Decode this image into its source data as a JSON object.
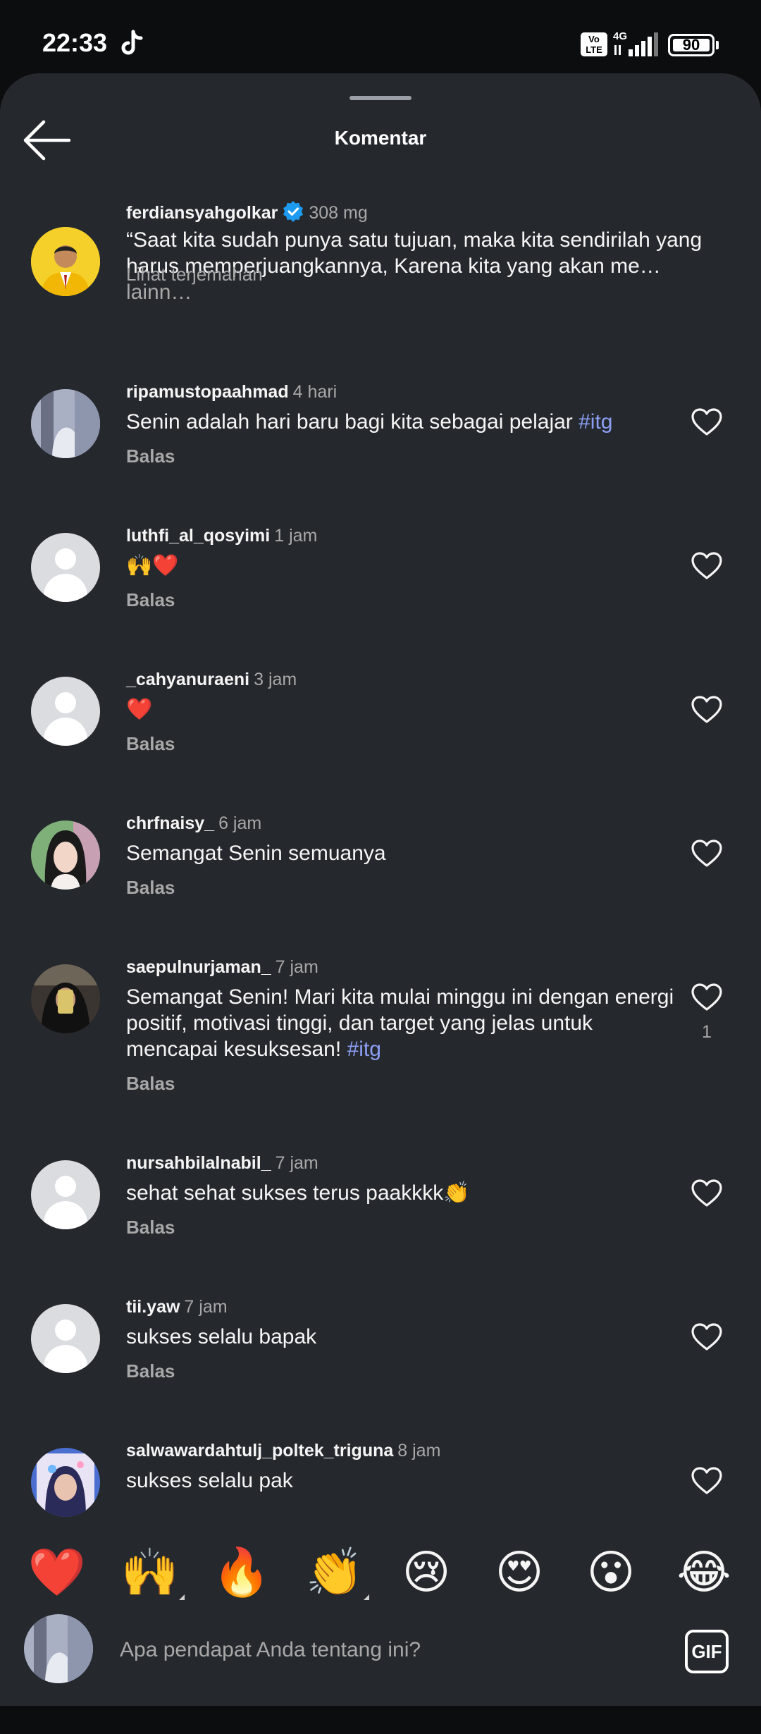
{
  "status_bar": {
    "time": "22:33",
    "volte": "Vo LTE",
    "network": "4G",
    "battery": "90"
  },
  "header": {
    "title": "Komentar"
  },
  "caption": {
    "username": "ferdiansyahgolkar",
    "verified": true,
    "time": "308 mg",
    "text": "“Saat kita sudah punya satu tujuan, maka kita sendirilah yang harus memperjuangkannya, Karena kita yang akan me…",
    "more": " lainn…",
    "translate": "Lihat terjemahan"
  },
  "comments": [
    {
      "username": "ripamustopaahmad",
      "time": "4 hari",
      "text": "Senin adalah hari baru bagi kita sebagai pelajar ",
      "hashtag": "#itg",
      "reply": "Balas"
    },
    {
      "username": "luthfi_al_qosyimi",
      "time": "1 jam",
      "text": "🙌❤️",
      "reply": "Balas"
    },
    {
      "username": "_cahyanuraeni",
      "time": "3 jam",
      "text": "❤️",
      "reply": "Balas"
    },
    {
      "username": "chrfnaisy_",
      "time": "6 jam",
      "text": "Semangat Senin semuanya",
      "reply": "Balas"
    },
    {
      "username": "saepulnurjaman_",
      "time": "7 jam",
      "text": "Semangat Senin! Mari kita mulai minggu ini dengan energi positif, motivasi tinggi, dan target yang jelas untuk mencapai kesuksesan! ",
      "hashtag": "#itg",
      "reply": "Balas",
      "likes": "1"
    },
    {
      "username": "nursahbilalnabil_",
      "time": "7 jam",
      "text": "sehat sehat sukses terus paakkkk👏",
      "reply": "Balas"
    },
    {
      "username": "tii.yaw",
      "time": "7 jam",
      "text": "sukses selalu bapak",
      "reply": "Balas"
    },
    {
      "username": "salwawardahtulj_poltek_triguna",
      "time": "8 jam",
      "text": "sukses selalu pak"
    }
  ],
  "quick_reactions": [
    "❤️",
    "🙌",
    "🔥",
    "👏",
    "😢",
    "😍",
    "😮",
    "😂"
  ],
  "composer": {
    "placeholder": "Apa pendapat Anda tentang ini?",
    "gif_label": "GIF"
  },
  "colors": {
    "sheet_background": "#25282d",
    "hashtag": "#8c9ff5",
    "verified": "#1d9bf0",
    "secondary_text": "#a8a8a8"
  }
}
